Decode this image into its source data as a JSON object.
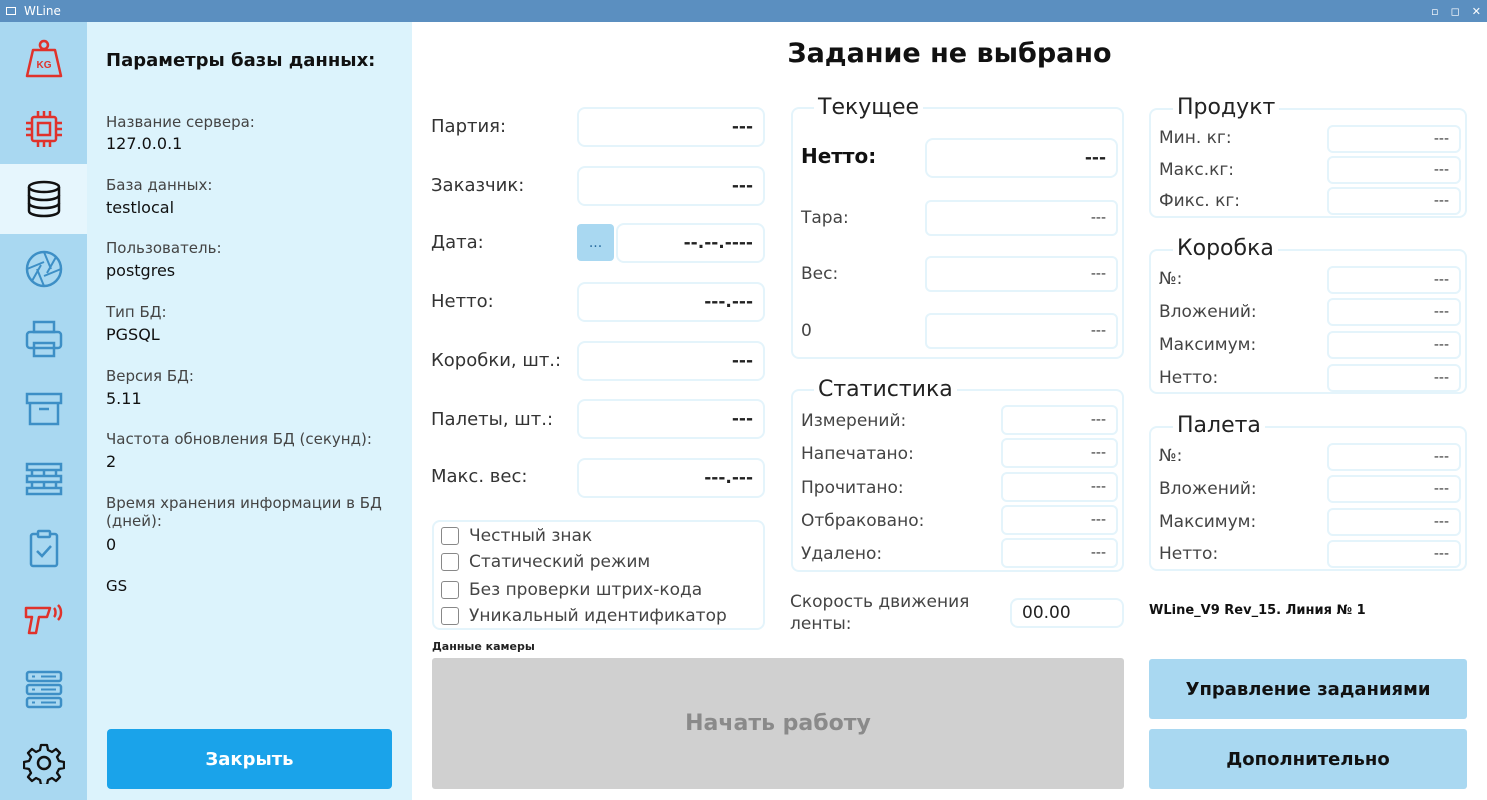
{
  "window": {
    "title": "WLine",
    "minimize": "▫",
    "maximize": "◻",
    "close": "✕"
  },
  "sidebar_icons": [
    {
      "name": "scale-kg-icon",
      "glyph": "KG"
    },
    {
      "name": "chip-icon"
    },
    {
      "name": "database-icon"
    },
    {
      "name": "camera-aperture-icon"
    },
    {
      "name": "printer-icon"
    },
    {
      "name": "archive-box-icon"
    },
    {
      "name": "pallet-icon"
    },
    {
      "name": "clipboard-check-icon"
    },
    {
      "name": "barcode-scanner-icon"
    },
    {
      "name": "server-icon"
    },
    {
      "name": "gear-icon"
    }
  ],
  "db_settings": {
    "title": "Параметры базы данных:",
    "server_label": "Название сервера:",
    "server_value": "127.0.0.1",
    "db_label": "База данных:",
    "db_value": "testlocal",
    "user_label": "Пользователь:",
    "user_value": "postgres",
    "type_label": "Тип БД:",
    "type_value": "PGSQL",
    "version_label": "Версия БД:",
    "version_value": "5.11",
    "refresh_label": "Частота обновления БД (секунд):",
    "refresh_value": "2",
    "retention_label": "Время хранения информации в БД (дней):",
    "retention_value": "0",
    "gs_label": "GS",
    "close_button": "Закрыть"
  },
  "main_title": "Задание не выбрано",
  "task": {
    "batch_label": "Партия:",
    "batch_value": "---",
    "customer_label": "Заказчик:",
    "customer_value": "---",
    "date_label": "Дата:",
    "date_button": "...",
    "date_value": "--.--.----",
    "net_label": "Нетто:",
    "net_value": "---.---",
    "boxes_label": "Коробки, шт.:",
    "boxes_value": "---",
    "pallets_label": "Палеты, шт.:",
    "pallets_value": "---",
    "maxw_label": "Макс. вес:",
    "maxw_value": "---.---"
  },
  "checkboxes": [
    {
      "label": "Честный знак",
      "checked": false
    },
    {
      "label": "Статический режим",
      "checked": false
    },
    {
      "label": "Без проверки штрих-кода",
      "checked": false
    },
    {
      "label": "Уникальный идентификатор",
      "checked": false
    }
  ],
  "current": {
    "title": "Текущее",
    "net_label": "Нетто:",
    "net_value": "---",
    "tare_label": "Тара:",
    "tare_value": "---",
    "weight_label": "Вес:",
    "weight_value": "---",
    "zero_label": "0",
    "zero_value": "---"
  },
  "stats": {
    "title": "Статистика",
    "measured_label": "Измерений:",
    "measured_value": "---",
    "printed_label": "Напечатано:",
    "printed_value": "---",
    "read_label": "Прочитано:",
    "read_value": "---",
    "rejected_label": "Отбраковано:",
    "rejected_value": "---",
    "deleted_label": "Удалено:",
    "deleted_value": "---"
  },
  "speed": {
    "label_line1": "Скорость движения",
    "label_line2": "ленты:",
    "value": "00.00"
  },
  "product": {
    "title": "Продукт",
    "min_label": "Мин. кг:",
    "min_value": "---",
    "max_label": "Макс.кг:",
    "max_value": "---",
    "fix_label": "Фикс. кг:",
    "fix_value": "---"
  },
  "box": {
    "title": "Коробка",
    "num_label": "№:",
    "num_value": "---",
    "nest_label": "Вложений:",
    "nest_value": "---",
    "max_label": "Максимум:",
    "max_value": "---",
    "net_label": "Нетто:",
    "net_value": "---"
  },
  "pallet": {
    "title": "Палета",
    "num_label": "№:",
    "num_value": "---",
    "nest_label": "Вложений:",
    "nest_value": "---",
    "max_label": "Максимум:",
    "max_value": "---",
    "net_label": "Нетто:",
    "net_value": "---"
  },
  "camera_label": "Данные камеры",
  "start_button": "Начать работу",
  "version_text": "WLine_V9 Rev_15. Линия № 1",
  "manage_button": "Управление заданиями",
  "extra_button": "Дополнительно",
  "colors": {
    "accent": "#1aa3ea",
    "sidebar": "#a9d8f1",
    "panel": "#dcf3fc",
    "red_icon": "#e0322b",
    "titlebar": "#5b8fc0"
  }
}
